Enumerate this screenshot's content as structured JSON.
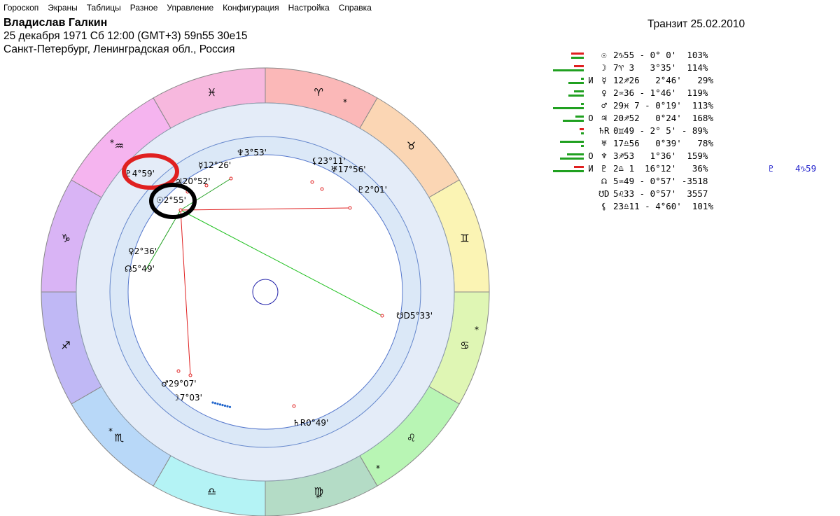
{
  "menu": [
    "Гороскоп",
    "Экраны",
    "Таблицы",
    "Разное",
    "Управление",
    "Конфигурация",
    "Настройка",
    "Справка"
  ],
  "person": {
    "name": "Владислав Галкин",
    "datetime": "25 декабря 1971  Сб  12:00 (GMT+3) 59n55  30e15",
    "place": "Санкт-Петербург, Ленинградская обл., Россия"
  },
  "transit": "Транзит 25.02.2010",
  "planets": [
    {
      "name": "sun",
      "glyph": "☉",
      "mark": "",
      "pos": "2♑55 - 0° 0'  103%",
      "bars": [
        {
          "w": 18,
          "c": "#e02020"
        },
        {
          "w": 18,
          "c": "#20a020"
        }
      ]
    },
    {
      "name": "moon",
      "glyph": "☽",
      "mark": "",
      "pos": "7♈ 3   3°35'  114%",
      "bars": [
        {
          "w": 14,
          "c": "#e02020"
        },
        {
          "w": 44,
          "c": "#20a020"
        }
      ]
    },
    {
      "name": "mercury",
      "glyph": "☿",
      "mark": "И",
      "pos": "12♐26   2°46'   29%",
      "bars": [
        {
          "w": 4,
          "c": "#20a020"
        },
        {
          "w": 22,
          "c": "#20a020"
        }
      ]
    },
    {
      "name": "venus",
      "glyph": "♀",
      "mark": "",
      "pos": "2♒36 - 1°46'  119%",
      "bars": [
        {
          "w": 14,
          "c": "#20a020"
        },
        {
          "w": 22,
          "c": "#20a020"
        }
      ]
    },
    {
      "name": "mars",
      "glyph": "♂",
      "mark": "",
      "pos": "29♓ 7 - 0°19'  113%",
      "bars": [
        {
          "w": 4,
          "c": "#20a020"
        },
        {
          "w": 44,
          "c": "#20a020"
        }
      ]
    },
    {
      "name": "jupiter",
      "glyph": "♃",
      "mark": "О",
      "pos": "20♐52   0°24'  168%",
      "bars": [
        {
          "w": 12,
          "c": "#20a020"
        },
        {
          "w": 30,
          "c": "#20a020"
        }
      ]
    },
    {
      "name": "saturn",
      "glyph": "♄R",
      "mark": "",
      "pos": "0♊49 - 2° 5' - 89%",
      "bars": [
        {
          "w": 6,
          "c": "#e02020"
        },
        {
          "w": 4,
          "c": "#20a020"
        }
      ]
    },
    {
      "name": "uranus",
      "glyph": "♅",
      "mark": "",
      "pos": "17♎56   0°39'   78%",
      "bars": [
        {
          "w": 34,
          "c": "#20a020"
        },
        {
          "w": 4,
          "c": "#20a020"
        }
      ]
    },
    {
      "name": "neptune",
      "glyph": "♆",
      "mark": "О",
      "pos": "3♐53   1°36'  159%",
      "bars": [
        {
          "w": 24,
          "c": "#20a020"
        },
        {
          "w": 34,
          "c": "#20a020"
        }
      ]
    },
    {
      "name": "pluto",
      "glyph": "♇",
      "mark": "И",
      "pos": "2♎ 1  16°12'   36%",
      "bars": [
        {
          "w": 14,
          "c": "#e02020"
        },
        {
          "w": 44,
          "c": "#20a020"
        }
      ],
      "transit_glyph": "♇",
      "transit_pos": "4♑59"
    },
    {
      "name": "north-node",
      "glyph": "☊",
      "mark": "",
      "pos": "5♒49 - 0°57' -3518",
      "bars": []
    },
    {
      "name": "south-node",
      "glyph": "☋D",
      "mark": "",
      "pos": "5♌33 - 0°57'  3557",
      "bars": []
    },
    {
      "name": "lilith",
      "glyph": "⚸",
      "mark": "",
      "pos": "23♎11 - 4°60'  101%",
      "bars": []
    }
  ],
  "wheel": {
    "signs": [
      {
        "name": "capricorn",
        "glyph": "♑",
        "color": "#d9b4f5"
      },
      {
        "name": "aquarius",
        "glyph": "♒",
        "color": "#f5b4ef"
      },
      {
        "name": "pisces",
        "glyph": "♓",
        "color": "#f7b8de"
      },
      {
        "name": "aries",
        "glyph": "♈",
        "color": "#fbb8b8"
      },
      {
        "name": "taurus",
        "glyph": "♉",
        "color": "#fbd6b4"
      },
      {
        "name": "gemini",
        "glyph": "♊",
        "color": "#fbf4b4"
      },
      {
        "name": "cancer",
        "glyph": "♋",
        "color": "#dff6b4"
      },
      {
        "name": "leo",
        "glyph": "♌",
        "color": "#b8f5b4"
      },
      {
        "name": "virgo",
        "glyph": "♍",
        "color": "#b4dcc6"
      },
      {
        "name": "libra",
        "glyph": "♎",
        "color": "#b4f3f5"
      },
      {
        "name": "scorpio",
        "glyph": "♏",
        "color": "#b8d8f8"
      },
      {
        "name": "sagittarius",
        "glyph": "♐",
        "color": "#c0b8f5"
      }
    ],
    "labels": [
      {
        "name": "transit-pluto-label",
        "glyph": "♇",
        "text": "4°59'",
        "color": "#2222cc"
      },
      {
        "name": "sun-label",
        "glyph": "☉",
        "text": "2°55'",
        "color": "#000"
      },
      {
        "name": "jupiter-label",
        "glyph": "♃",
        "text": "20°52'",
        "color": "#000"
      },
      {
        "name": "mercury-label",
        "glyph": "☿",
        "text": "12°26'",
        "color": "#000"
      },
      {
        "name": "neptune-label",
        "glyph": "♆",
        "text": "3°53'",
        "color": "#000"
      },
      {
        "name": "lilith-label",
        "glyph": "⚸",
        "text": "23°11'",
        "color": "#000"
      },
      {
        "name": "uranus-label",
        "glyph": "♅",
        "text": "17°56'",
        "color": "#000"
      },
      {
        "name": "pluto-label",
        "glyph": "♇",
        "text": "2°01'",
        "color": "#000"
      },
      {
        "name": "venus-label",
        "glyph": "♀",
        "text": "2°36'",
        "color": "#000"
      },
      {
        "name": "north-node-label",
        "glyph": "☊",
        "text": "5°49'",
        "color": "#000"
      },
      {
        "name": "south-node-label",
        "glyph": "☋D",
        "text": "5°33'",
        "color": "#000"
      },
      {
        "name": "mars-label",
        "glyph": "♂",
        "text": "29°07'",
        "color": "#000"
      },
      {
        "name": "moon-label",
        "glyph": "☽",
        "text": "7°03'",
        "color": "#000"
      },
      {
        "name": "saturn-label",
        "glyph": "♄R",
        "text": "0°49'",
        "color": "#000"
      }
    ],
    "highlight_colors": {
      "red": "#e02020",
      "black": "#000000"
    }
  }
}
